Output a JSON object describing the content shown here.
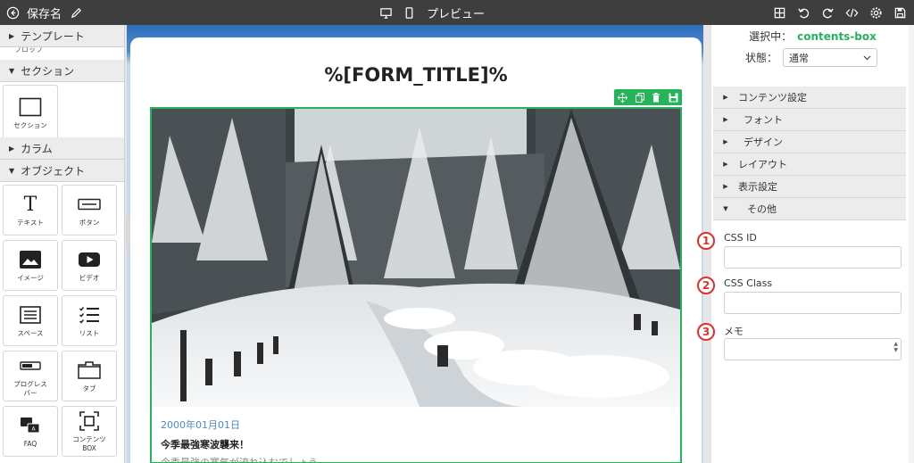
{
  "topbar": {
    "save_label": "保存名",
    "preview_label": "プレビュー"
  },
  "left_panel": {
    "template_label": "テンプレート",
    "template_peek": "プロップ",
    "section_label": "セクション",
    "section_tile_label": "セクション",
    "column_label": "カラム",
    "object_label": "オブジェクト",
    "tiles": [
      {
        "label": "テキスト",
        "icon": "text-icon"
      },
      {
        "label": "ボタン",
        "icon": "button-icon"
      },
      {
        "label": "イメージ",
        "icon": "image-icon"
      },
      {
        "label": "ビデオ",
        "icon": "video-icon"
      },
      {
        "label": "スペース",
        "icon": "space-icon"
      },
      {
        "label": "リスト",
        "icon": "list-icon"
      },
      {
        "label": "プログレス\nバー",
        "icon": "progress-bar-icon"
      },
      {
        "label": "タブ",
        "icon": "tab-icon"
      },
      {
        "label": "FAQ",
        "icon": "faq-icon"
      },
      {
        "label": "コンテンツ\nBOX",
        "icon": "contents-box-icon"
      }
    ]
  },
  "canvas": {
    "form_title": "%[FORM_TITLE]%",
    "date": "2000年01月01日",
    "headline": "今季最強寒波襲来！",
    "body_text": "今季最強の寒気が流れ込むでしょう"
  },
  "right_panel": {
    "selected_label": "選択中：",
    "selected_value": "contents-box",
    "state_label": "状態：",
    "state_value": "通常",
    "accordion": [
      "コンテンツ設定",
      "フォント",
      "デザイン",
      "レイアウト",
      "表示設定",
      "その他"
    ],
    "css_id_label": "CSS ID",
    "css_class_label": "CSS Class",
    "memo_label": "メモ",
    "badges": [
      "1",
      "2",
      "3"
    ]
  },
  "colors": {
    "accent_green": "#27b35a",
    "topbar": "#3e3e3e",
    "badge_red": "#d9332a",
    "date_blue": "#4f89c9"
  }
}
